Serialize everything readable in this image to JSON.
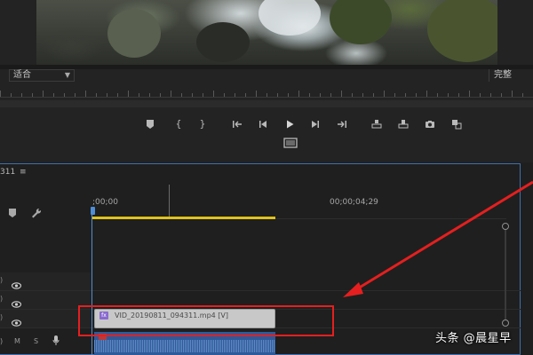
{
  "monitor": {
    "zoom_label": "适合",
    "quality_label": "完整"
  },
  "transport_icons": [
    "marker-icon",
    "mark-in-icon",
    "mark-out-icon",
    "go-to-in-icon",
    "step-back-icon",
    "play-icon",
    "step-forward-icon",
    "go-to-out-icon",
    "insert-icon",
    "overwrite-icon",
    "camera-icon",
    "compare-icon"
  ],
  "timeline": {
    "sequence_name": "311",
    "menu_glyph": "≡",
    "timecode_start": ";00;00",
    "timecode_mid": "00;00;04;29",
    "clip_video_name": "VID_20190811_094311.mp4 [V]",
    "clip_badge": "fx",
    "audio_ctrl_m": "M",
    "audio_ctrl_s": "S",
    "highlight_color": "#e51f1f",
    "playhead_color": "#4f8ed6",
    "work_area_color": "#e0c21a"
  },
  "watermark": "头条 @晨星早"
}
